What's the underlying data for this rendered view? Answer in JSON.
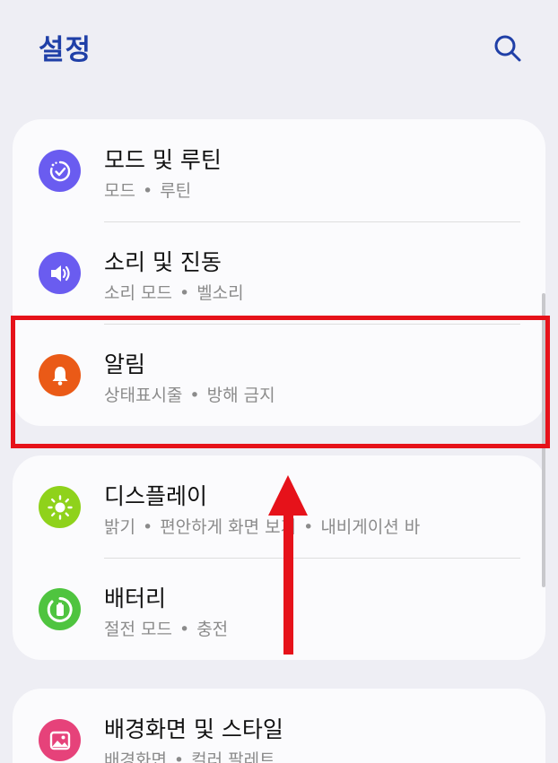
{
  "header": {
    "title": "설정",
    "search_icon": "search-icon"
  },
  "sections": [
    {
      "items": [
        {
          "title": "모드 및 루틴",
          "sub": [
            "모드",
            "루틴"
          ],
          "icon": "routine-check-icon",
          "color": "#6a5cf0"
        },
        {
          "title": "소리 및 진동",
          "sub": [
            "소리 모드",
            "벨소리"
          ],
          "icon": "speaker-icon",
          "color": "#6a5cf0"
        },
        {
          "title": "알림",
          "sub": [
            "상태표시줄",
            "방해 금지"
          ],
          "icon": "bell-icon",
          "color": "#ea5a17"
        }
      ]
    },
    {
      "items": [
        {
          "title": "디스플레이",
          "sub": [
            "밝기",
            "편안하게 화면 보기",
            "내비게이션 바"
          ],
          "icon": "sun-icon",
          "color": "#8fd21b"
        },
        {
          "title": "배터리",
          "sub": [
            "절전 모드",
            "충전"
          ],
          "icon": "battery-icon",
          "color": "#4fc43f"
        }
      ]
    },
    {
      "items": [
        {
          "title": "배경화면 및 스타일",
          "sub": [
            "배경화면",
            "컬러 팔레트"
          ],
          "icon": "image-icon",
          "color": "#e6427a"
        }
      ]
    }
  ],
  "annotation": {
    "highlight_color": "#e6121a"
  }
}
